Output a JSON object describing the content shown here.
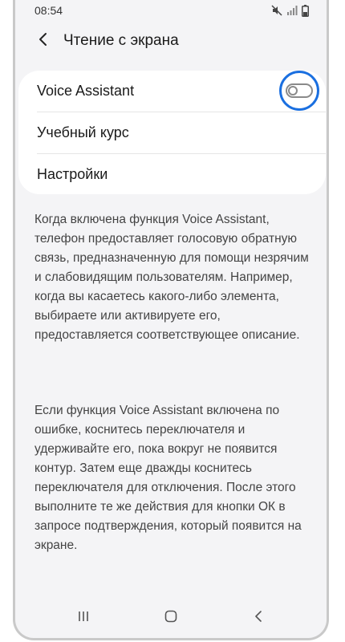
{
  "status_bar": {
    "time": "08:54",
    "icons": [
      "mute-icon",
      "signal-icon",
      "battery-icon"
    ]
  },
  "app_bar": {
    "title": "Чтение с экрана",
    "back_icon": "chevron-left-icon"
  },
  "settings": {
    "items": [
      {
        "label": "Voice Assistant",
        "toggle": "off"
      },
      {
        "label": "Учебный курс"
      },
      {
        "label": "Настройки"
      }
    ]
  },
  "description": {
    "paragraph1": "Когда включена функция Voice Assistant, телефон предоставляет голосовую обратную связь, предназначенную для помощи незрячим и слабовидящим пользователям. Например, когда вы касаетесь какого-либо элемента, выбираете или активируете его, предоставляется соответствующее описание.",
    "paragraph2": "Если функция Voice Assistant включена по ошибке, коснитесь переключателя и удерживайте его, пока вокруг не появится контур. Затем еще дважды коснитесь переключателя для отключения. После этого выполните те же действия для кнопки ОК в запросе подтверждения, который появится на экране."
  },
  "colors": {
    "highlight_ring": "#1a6fe0",
    "background": "#f4f4f6",
    "card": "#ffffff"
  },
  "nav_bar": {
    "icons": [
      "recent-apps-icon",
      "home-icon",
      "back-icon"
    ]
  }
}
